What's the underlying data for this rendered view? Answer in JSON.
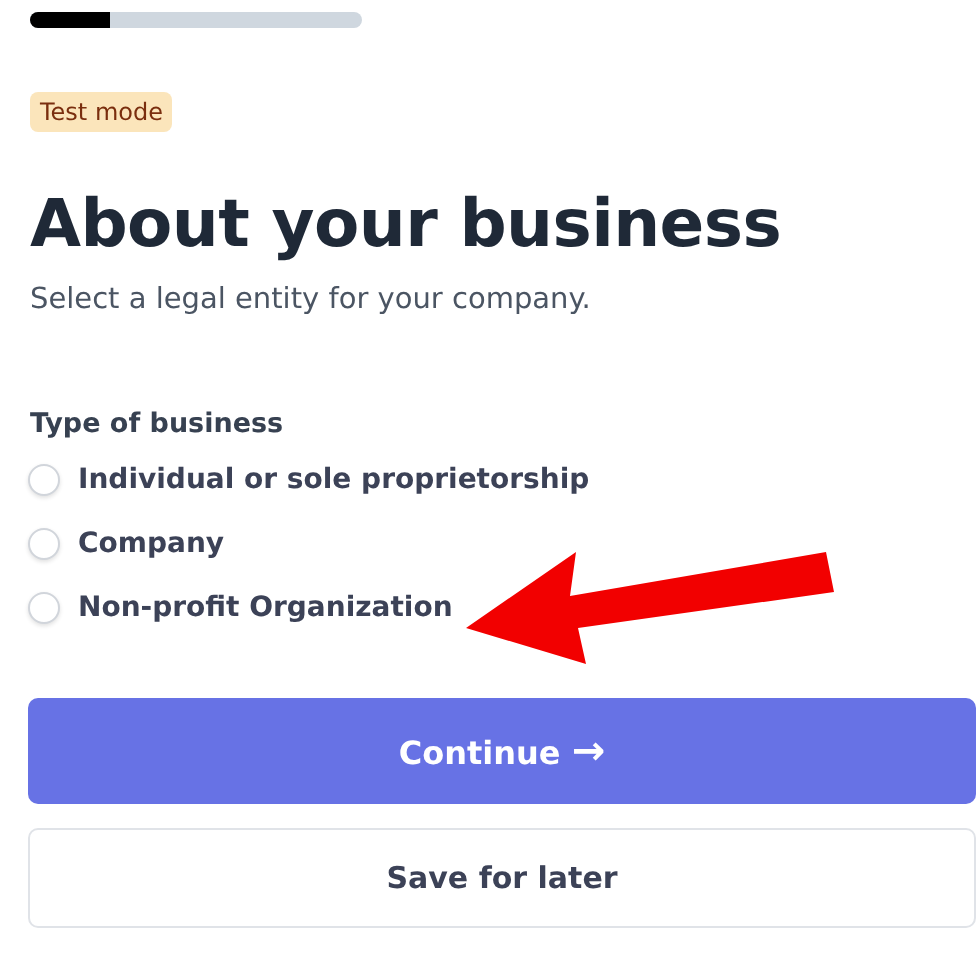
{
  "progress": {
    "level": 0.24
  },
  "badge": "Test mode",
  "heading": "About your business",
  "subtitle": "Select a legal entity for your company.",
  "field_label": "Type of business",
  "options": [
    {
      "label": "Individual or sole proprietorship",
      "selected": false
    },
    {
      "label": "Company",
      "selected": false
    },
    {
      "label": "Non-profit Organization",
      "selected": false
    }
  ],
  "primary_button": {
    "label": "Continue",
    "icon": "→"
  },
  "secondary_button": "Save for later"
}
